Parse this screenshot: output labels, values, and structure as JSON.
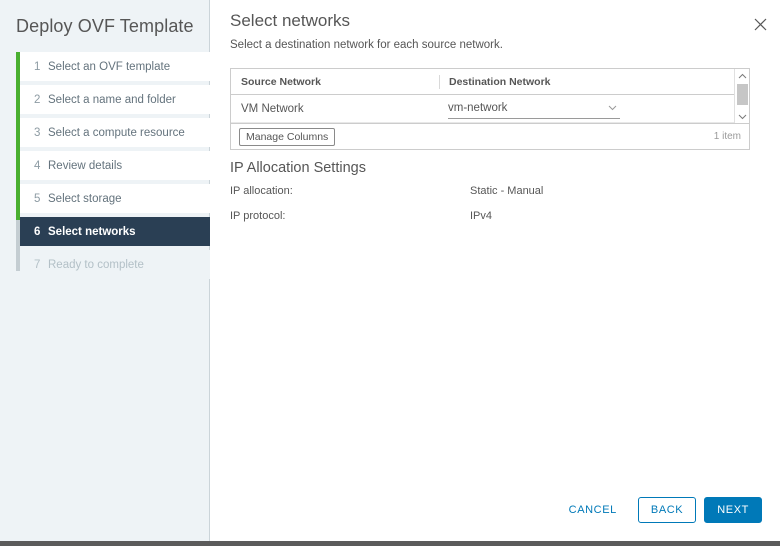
{
  "wizard": {
    "title": "Deploy OVF Template",
    "steps": [
      {
        "num": "1",
        "label": "Select an OVF template",
        "state": "done"
      },
      {
        "num": "2",
        "label": "Select a name and folder",
        "state": "done"
      },
      {
        "num": "3",
        "label": "Select a compute resource",
        "state": "done"
      },
      {
        "num": "4",
        "label": "Review details",
        "state": "done"
      },
      {
        "num": "5",
        "label": "Select storage",
        "state": "done"
      },
      {
        "num": "6",
        "label": "Select networks",
        "state": "active"
      },
      {
        "num": "7",
        "label": "Ready to complete",
        "state": "pending"
      }
    ],
    "progress_color": "#49af30",
    "active_color": "#2a3f54"
  },
  "page": {
    "title": "Select networks",
    "subtitle": "Select a destination network for each source network.",
    "close_icon": "close-icon"
  },
  "table": {
    "columns": [
      "Source Network",
      "Destination Network"
    ],
    "rows": [
      {
        "source": "VM Network",
        "destination": "vm-network"
      }
    ],
    "manage_columns_label": "Manage Columns",
    "item_count": "1 item",
    "scroll_up_icon": "chevron-up-icon",
    "scroll_down_icon": "chevron-down-icon",
    "select_chevron_icon": "chevron-down-icon"
  },
  "ip_allocation": {
    "section_title": "IP Allocation Settings",
    "rows": [
      {
        "key": "IP allocation:",
        "value": "Static - Manual"
      },
      {
        "key": "IP protocol:",
        "value": "IPv4"
      }
    ]
  },
  "footer": {
    "cancel_label": "CANCEL",
    "back_label": "BACK",
    "next_label": "NEXT",
    "accent_color": "#0079b8"
  }
}
